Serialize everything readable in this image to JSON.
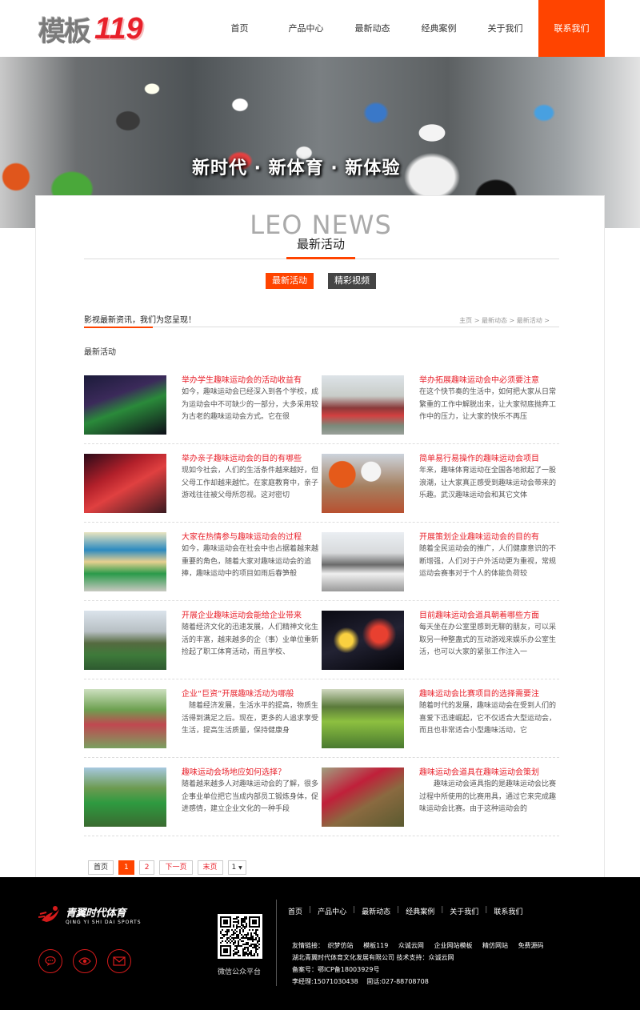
{
  "header": {
    "logo_cn": "模板",
    "logo_num": "119",
    "nav": [
      "首页",
      "产品中心",
      "最新动态",
      "经典案例",
      "关于我们",
      "联系我们"
    ]
  },
  "banner": {
    "slogan": "新时代 · 新体育 · 新体验"
  },
  "section": {
    "title_en": "LEO NEWS",
    "title_cn": "最新活动",
    "tabs": [
      "最新活动",
      "精彩视频"
    ],
    "slogan": "影视最新资讯，我们为您呈现！",
    "breadcrumb": "主页 > 最新动态 > 最新活动 >",
    "category": "最新活动"
  },
  "news": [
    {
      "title": "举办学生趣味运动会的活动收益有",
      "desc": "如今，趣味运动会已经深入到各个学校，成为运动会中不可缺少的一部分，大多采用较为古老的趣味运动会方式。它在很"
    },
    {
      "title": "举办拓展趣味运动会中必须要注意",
      "desc": "在这个快节奏的生活中，如何把大家从日常繁重的工作中解脱出来，让大家彻底抛弃工作中的压力，让大家的快乐不再压"
    },
    {
      "title": "举办亲子趣味运动会的目的有哪些",
      "desc": "现如今社会，人们的生活条件越来越好，但父母工作却越来越忙。在家庭教育中，亲子游戏往往被父母所忽视。这对密切"
    },
    {
      "title": "简单易行易操作的趣味运动会项目",
      "desc": "年来，趣味体育运动在全国各地掀起了一股浪潮，让大家真正感受到趣味运动会带来的乐趣。武汉趣味运动会和其它文体"
    },
    {
      "title": "大家在热情参与趣味运动会的过程",
      "desc": "如今，趣味运动会在社会中也占据着越来越重要的角色，随着大家对趣味运动会的追捧，趣味运动中的项目如雨后春笋般"
    },
    {
      "title": "开展策划企业趣味运动会的目的有",
      "desc": "随着全民运动会的推广，人们健康意识的不断增强，人们对于户外活动更为重视，常规运动会赛事对于个人的体能负荷较"
    },
    {
      "title": "开展企业趣味运动会能给企业带来",
      "desc": "随着经济文化的迅速发展，人们精神文化生活的丰富，越来越多的企（事）业单位重新捡起了职工体育活动，而且学校、"
    },
    {
      "title": "目前趣味运动会道具朝着哪些方面",
      "desc": "每天坐在办公室里感到无聊的朋友，可以采取另一种整蛊式的互动游戏来娱乐办公室生活，也可以大家的紧张工作注入一"
    },
    {
      "title": "企业“巨资”开展趣味活动为哪般",
      "desc": "　随着经济发展，生活水平的提高，物质生活得到满足之后。现在，更多的人追求享受生活，提高生活质量，保持健康身"
    },
    {
      "title": "趣味运动会比赛项目的选择需要注",
      "desc": "随着时代的发展，趣味运动会在受到人们的喜爱下迅速崛起，它不仅适合大型运动会，而且也非常适合小型趣味活动，它"
    },
    {
      "title": "趣味运动会场地应如何选择？",
      "desc": "随着越来越多人对趣味运动会的了解，很多企事业单位把它当成内部员工锻炼身体，促进感情，建立企业文化的一种手段"
    },
    {
      "title": "趣味运动会道具在趣味运动会策划",
      "desc": "　　趣味运动会道具指的是趣味运动会比赛过程中所使用的比赛用具，通过它来完成趣味运动会比赛。由于这种运动会的"
    }
  ],
  "pager": {
    "first": "首页",
    "pages": [
      "1",
      "2"
    ],
    "next": "下一页",
    "last": "末页",
    "select": "1"
  },
  "footer": {
    "brand_cn": "青翼时代体育",
    "brand_en": "QING YI SHI DAI SPORTS",
    "qr_label": "微信公众平台",
    "nav": [
      "首页",
      "产品中心",
      "最新动态",
      "经典案例",
      "关于我们",
      "联系我们"
    ],
    "links_label": "友情链接：",
    "links": [
      "织梦仿站",
      "模板119",
      "众诚云网",
      "企业网站模板",
      "精仿网站",
      "免费源码"
    ],
    "company": "湖北青翼时代体育文化发展有限公司 技术支持：众诚云网",
    "icp": "备案号：鄂ICP备18003929号",
    "contact": "李经理:15071030438　 固话:027-88708708"
  },
  "colors": {
    "accent": "#ff4400",
    "title_red": "#e8202a",
    "footer_bg": "#000000"
  }
}
